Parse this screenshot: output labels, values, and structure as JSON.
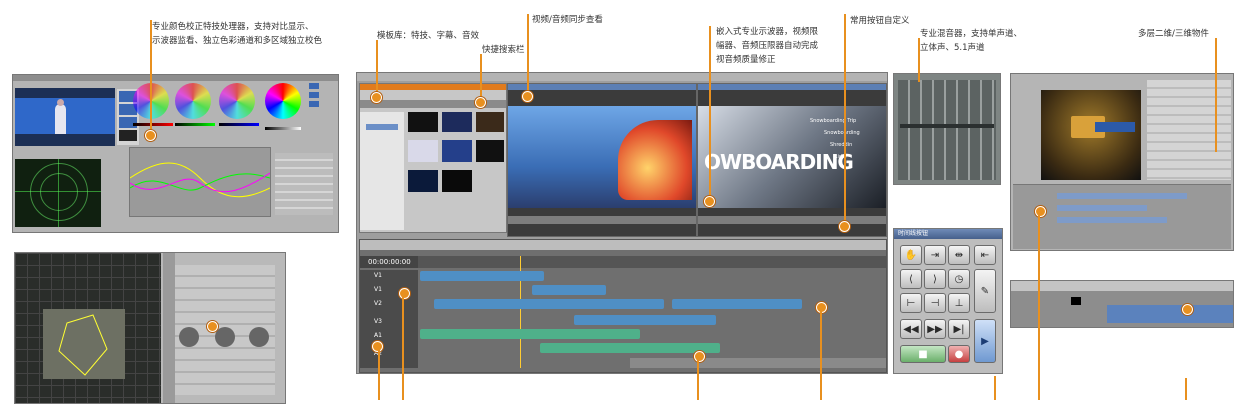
{
  "captions": {
    "color_correction": [
      "专业颜色校正特技处理器，支持对比显示、",
      "示波器监看、独立色彩通道和多区域独立校色"
    ],
    "template_library": "模板库：特技、字幕、音效",
    "quick_search": "快捷搜索栏",
    "av_sync": "视频/音频同步查看",
    "scope": [
      "嵌入式专业示波器，视频限",
      "幅器、音频压限器自动完成",
      "视音频质量修正"
    ],
    "custom_buttons": "常用按钮自定义",
    "mixer": [
      "专业混音器，支持单声道、",
      "立体声、5.1声道"
    ],
    "objects_3d": "多层二维/三维物件"
  },
  "editor": {
    "timecode": "00:00:00:00",
    "track_labels": [
      "V1",
      "V1",
      "V2",
      "V3",
      "A1",
      "A2"
    ],
    "monitor_text": [
      "Snowboarding Trip",
      "Snowboarding",
      "Shreddin",
      "Ridin"
    ],
    "monitor_big_text": "OWBOARDING"
  },
  "button_panel": {
    "title": "时间线按钮"
  },
  "colors": {
    "accent": "#e8901f",
    "track_video": "#4f8fc5",
    "track_audio": "#4fb08a"
  }
}
